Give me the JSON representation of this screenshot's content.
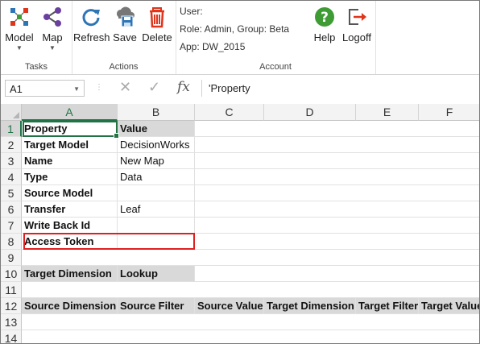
{
  "ribbon": {
    "tasks": {
      "label": "Tasks",
      "model_label": "Model",
      "map_label": "Map"
    },
    "actions": {
      "label": "Actions",
      "refresh_label": "Refresh",
      "save_label": "Save",
      "delete_label": "Delete"
    },
    "account": {
      "label": "Account",
      "user_line": "User:",
      "role_line": "Role: Admin, Group: Beta",
      "app_line": "App: DW_2015",
      "help_label": "Help",
      "logoff_label": "Logoff"
    },
    "icons": {
      "model": "model-icon",
      "map": "share-map-icon",
      "refresh": "refresh-icon",
      "save": "cloud-save-icon",
      "delete": "trash-icon",
      "help": "question-icon",
      "logoff": "logoff-icon"
    },
    "colors": {
      "accent": "#217346",
      "blue": "#2e75b6",
      "red": "#e0341b",
      "green": "#3f9c35"
    }
  },
  "formula_bar": {
    "name_box": "A1",
    "fx": "fx",
    "cancel": "✕",
    "enter": "✓",
    "value": "'Property"
  },
  "grid": {
    "columns": [
      "A",
      "B",
      "C",
      "D",
      "E",
      "F"
    ],
    "rows": [
      "1",
      "2",
      "3",
      "4",
      "5",
      "6",
      "7",
      "8",
      "9",
      "10",
      "11",
      "12",
      "13",
      "14"
    ],
    "cells": {
      "r1": {
        "a": "Property",
        "b": "Value"
      },
      "r2": {
        "a": "Target Model",
        "b": "DecisionWorks"
      },
      "r3": {
        "a": "Name",
        "b": "New Map"
      },
      "r4": {
        "a": "Type",
        "b": "Data"
      },
      "r5": {
        "a": "Source Model",
        "b": ""
      },
      "r6": {
        "a": "Transfer",
        "b": "Leaf"
      },
      "r7": {
        "a": "Write Back Id",
        "b": ""
      },
      "r8": {
        "a": "Access Token",
        "b": ""
      },
      "r10": {
        "a": "Target Dimension",
        "b": "Lookup"
      },
      "r12": {
        "a": "Source Dimension",
        "b": "Source Filter",
        "c": "Source Value",
        "d": "Target Dimension",
        "e": "Target Filter",
        "f": "Target Value"
      }
    }
  }
}
